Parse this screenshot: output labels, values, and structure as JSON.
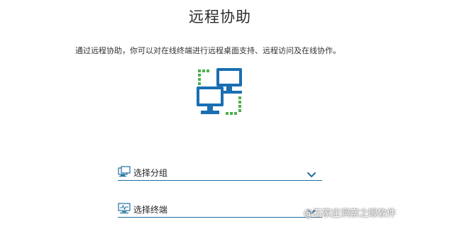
{
  "page": {
    "title": "远程协助",
    "description": "通过远程协助，你可以对在线终端进行远程桌面支持、远程访问及在线协作。"
  },
  "hero": {
    "icon": "remote-desktop-computers-icon",
    "colors": {
      "screen": "#1a6fb3",
      "screen_inner": "#ffffff",
      "connector": "#4cb04c"
    }
  },
  "selectors": [
    {
      "label": "选择分组",
      "icon": "group-icon",
      "chevron": "chevron-down-icon"
    },
    {
      "label": "选择终端",
      "icon": "terminal-icon",
      "chevron": "chevron-down-icon"
    }
  ],
  "theme": {
    "accent": "#1f6f9e",
    "chevron": "#1f6f9e"
  },
  "watermark": "@石家庄洞察之眼软件"
}
